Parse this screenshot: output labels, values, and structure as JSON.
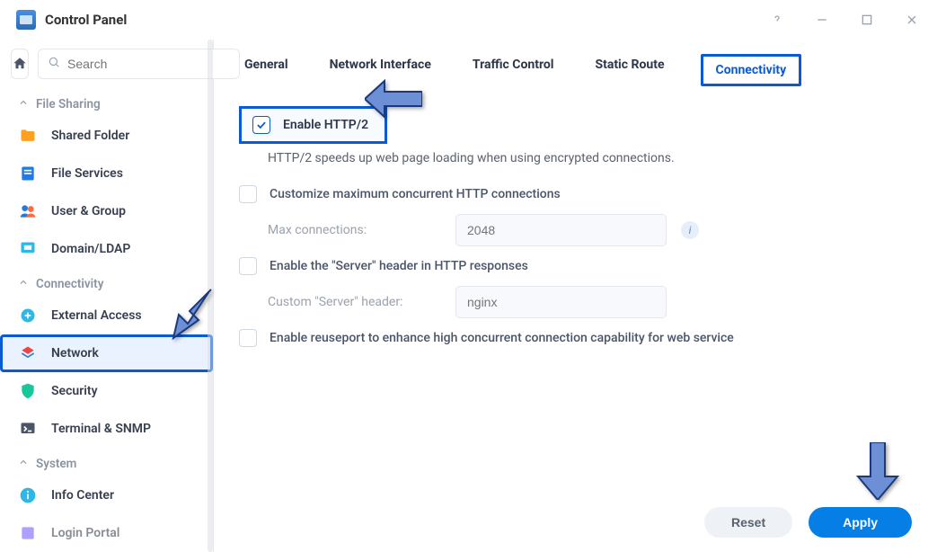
{
  "window": {
    "title": "Control Panel"
  },
  "search": {
    "placeholder": "Search"
  },
  "sections": {
    "file_sharing": {
      "label": "File Sharing"
    },
    "connectivity": {
      "label": "Connectivity"
    },
    "system": {
      "label": "System"
    }
  },
  "nav": {
    "shared_folder": "Shared Folder",
    "file_services": "File Services",
    "user_group": "User & Group",
    "domain_ldap": "Domain/LDAP",
    "external_access": "External Access",
    "network": "Network",
    "security": "Security",
    "terminal_snmp": "Terminal & SNMP",
    "info_center": "Info Center",
    "login_portal": "Login Portal"
  },
  "tabs": {
    "general": "General",
    "network_interface": "Network Interface",
    "traffic_control": "Traffic Control",
    "static_route": "Static Route",
    "connectivity": "Connectivity"
  },
  "form": {
    "enable_http2": {
      "label": "Enable HTTP/2",
      "checked": true
    },
    "http2_desc": "HTTP/2 speeds up web page loading when using encrypted connections.",
    "customize_conn": {
      "label": "Customize maximum concurrent HTTP connections",
      "checked": false
    },
    "max_conn_label": "Max connections:",
    "max_conn_value": "2048",
    "enable_server_header": {
      "label": "Enable the \"Server\" header in HTTP responses",
      "checked": false
    },
    "custom_server_header_label": "Custom \"Server\" header:",
    "custom_server_header_value": "nginx",
    "enable_reuseport": {
      "label": "Enable reuseport to enhance high concurrent connection capability for web service",
      "checked": false
    }
  },
  "footer": {
    "reset": "Reset",
    "apply": "Apply"
  }
}
